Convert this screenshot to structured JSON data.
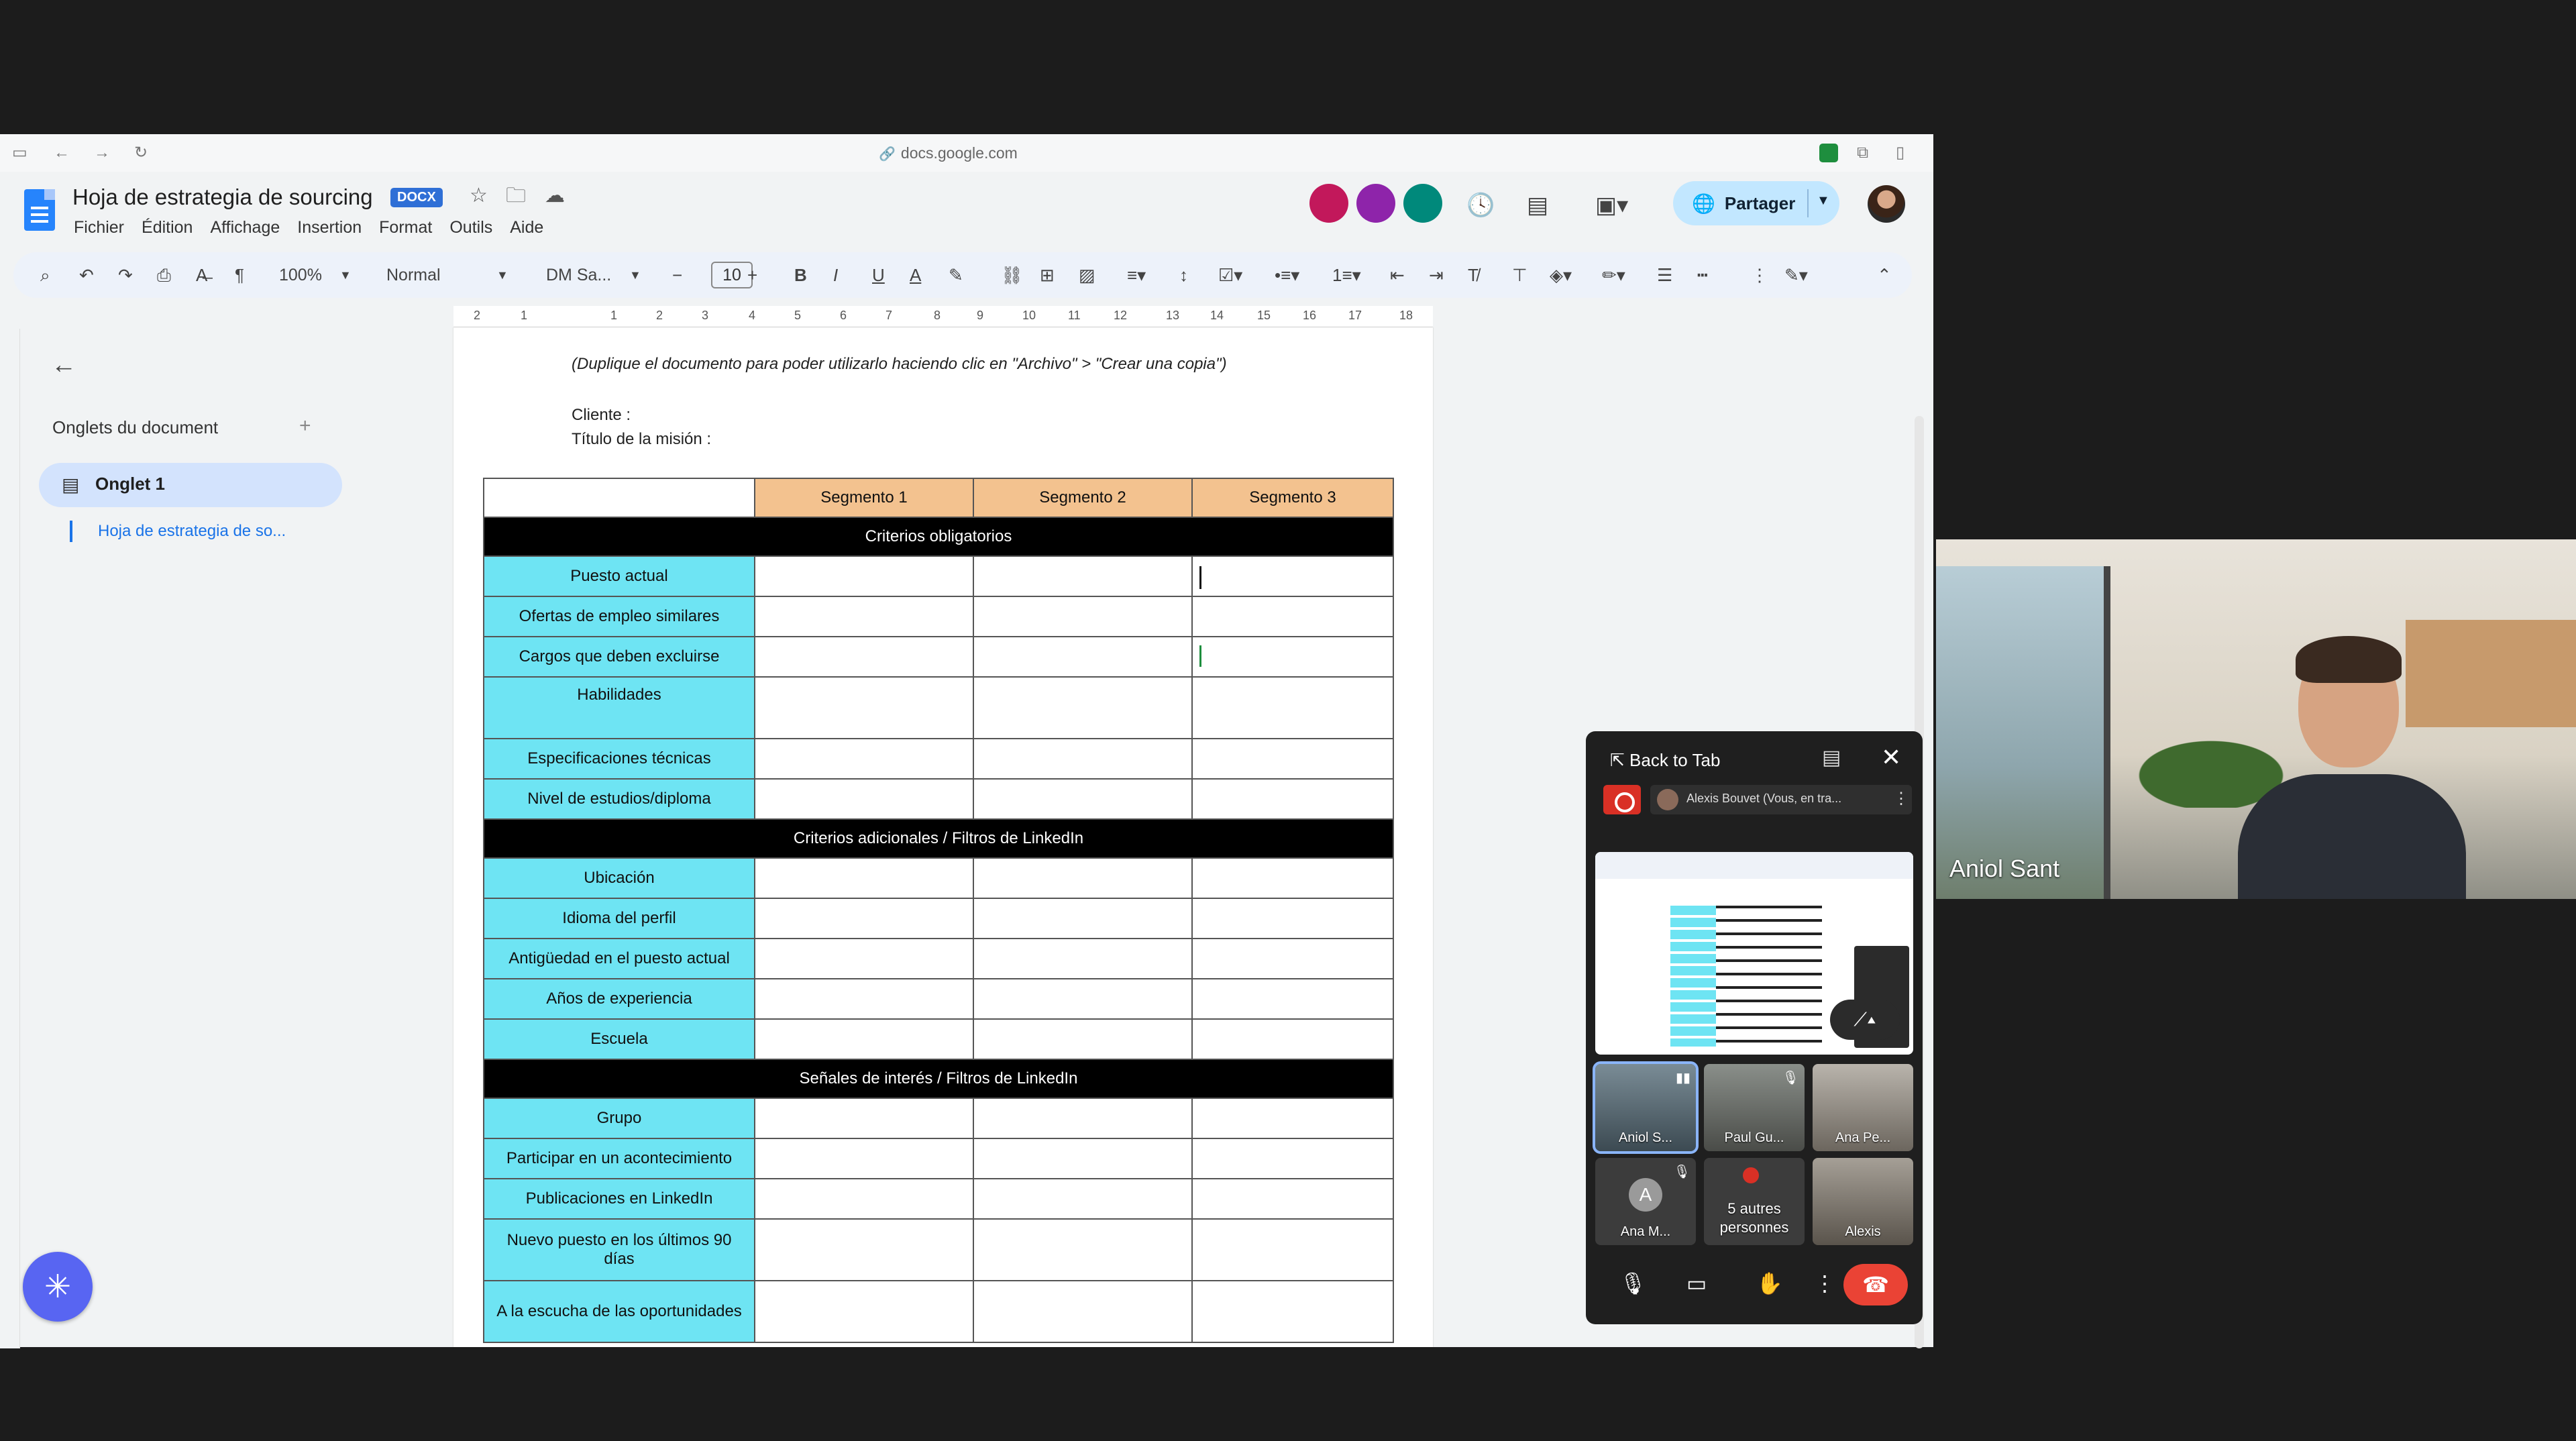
{
  "browser": {
    "url": "docs.google.com"
  },
  "doc": {
    "title": "Hoja de estrategia de sourcing",
    "badge": "DOCX",
    "menu": [
      "Fichier",
      "Édition",
      "Affichage",
      "Insertion",
      "Format",
      "Outils",
      "Aide"
    ],
    "share_label": "Partager"
  },
  "toolbar": {
    "zoom": "100%",
    "style": "Normal",
    "font": "DM Sa...",
    "font_size": "10"
  },
  "ruler_numbers": [
    "2",
    "1",
    "1",
    "2",
    "3",
    "4",
    "5",
    "6",
    "7",
    "8",
    "9",
    "10",
    "11",
    "12",
    "13",
    "14",
    "15",
    "16",
    "17",
    "18"
  ],
  "side_panel": {
    "title": "Onglets du document",
    "tab_label": "Onglet 1",
    "sub_item": "Hoja de estrategia de so..."
  },
  "page": {
    "note": "(Duplique el documento para poder utilizarlo haciendo clic en \"Archivo\" > \"Crear una copia\")",
    "client_label": "Cliente :",
    "mission_label": "Título de la misión :"
  },
  "table": {
    "headers": [
      "Segmento 1",
      "Segmento 2",
      "Segmento 3"
    ],
    "sections": [
      {
        "title": "Criterios obligatorios",
        "rows": [
          "Puesto actual",
          "Ofertas de empleo similares",
          "Cargos que deben excluirse",
          "Habilidades",
          "Especificaciones técnicas",
          "Nivel de estudios/diploma"
        ]
      },
      {
        "title": "Criterios adicionales / Filtros de LinkedIn",
        "rows": [
          "Ubicación",
          "Idioma del perfil",
          "Antigüedad en el puesto actual",
          "Años de experiencia",
          "Escuela"
        ]
      },
      {
        "title": "Señales de interés / Filtros de LinkedIn",
        "rows": [
          "Grupo",
          "Participar en un acontecimiento",
          "Publicaciones en LinkedIn",
          "Nuevo puesto en los últimos 90 días",
          "A la escucha de las oportunidades"
        ]
      }
    ]
  },
  "meet": {
    "back_label": "Back to Tab",
    "presenter": "Alexis Bouvet (Vous, en tra...",
    "tiles": [
      "Aniol S...",
      "Paul Gu...",
      "Ana Pe...",
      "Ana M...",
      "5 autres personnes",
      "Alexis"
    ]
  },
  "camera": {
    "name": "Aniol Sant"
  }
}
